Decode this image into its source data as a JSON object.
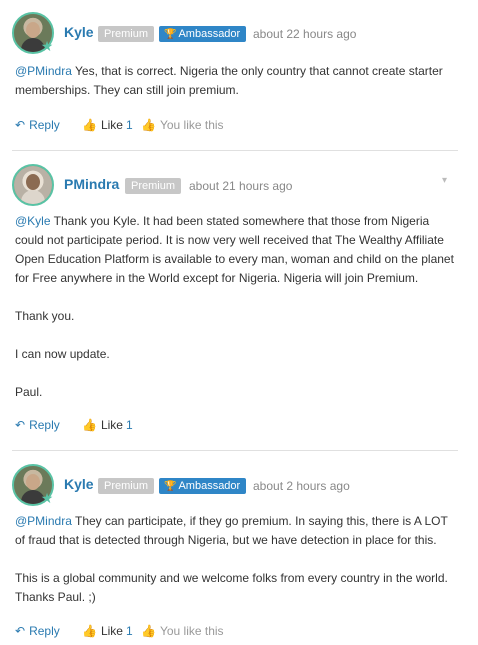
{
  "comments": [
    {
      "username": "Kyle",
      "badges": {
        "premium": "Premium",
        "ambassador": "Ambassador"
      },
      "timestamp": "about 22 hours ago",
      "mention": "@PMindra",
      "paragraphs": [
        "Yes, that is correct. Nigeria the only country that cannot create starter memberships. They can still join premium."
      ],
      "actions": {
        "reply": "Reply",
        "like": "Like",
        "like_count": "1",
        "you_like": "You like this"
      }
    },
    {
      "username": "PMindra",
      "badges": {
        "premium": "Premium"
      },
      "timestamp": "about 21 hours ago",
      "mention": "@Kyle",
      "paragraphs": [
        "Thank you Kyle. It had been stated somewhere that those from Nigeria could not participate period. It is now very well received that The Wealthy Affiliate Open Education Platform is available to every man, woman and child on the planet for Free anywhere in the World except for Nigeria. Nigeria will join Premium.",
        "Thank you.",
        "I can now update.",
        "Paul."
      ],
      "actions": {
        "reply": "Reply",
        "like": "Like",
        "like_count": "1"
      }
    },
    {
      "username": "Kyle",
      "badges": {
        "premium": "Premium",
        "ambassador": "Ambassador"
      },
      "timestamp": "about 2 hours ago",
      "mention": "@PMindra",
      "paragraphs": [
        "They can participate, if they go premium. In saying this, there is A LOT of fraud that is detected through Nigeria, but we have detection in place for this.",
        "This is a global community and we welcome folks from every country in the world. Thanks Paul. ;)"
      ],
      "actions": {
        "reply": "Reply",
        "like": "Like",
        "like_count": "1",
        "you_like": "You like this"
      }
    }
  ],
  "icons": {
    "reply": "reply-arrow-icon",
    "like": "thumbs-up-icon",
    "you_like": "thumbs-up-icon",
    "ambassador": "trophy-icon",
    "menu": "chevron-down-icon",
    "status": "star-icon"
  },
  "colors": {
    "link": "#2a7ab0",
    "premium_badge": "#c7c7c7",
    "ambassador_badge": "#2f86c7",
    "avatar_ring": "#59c3a5",
    "timestamp": "#888888",
    "divider": "#e0e0e0"
  }
}
